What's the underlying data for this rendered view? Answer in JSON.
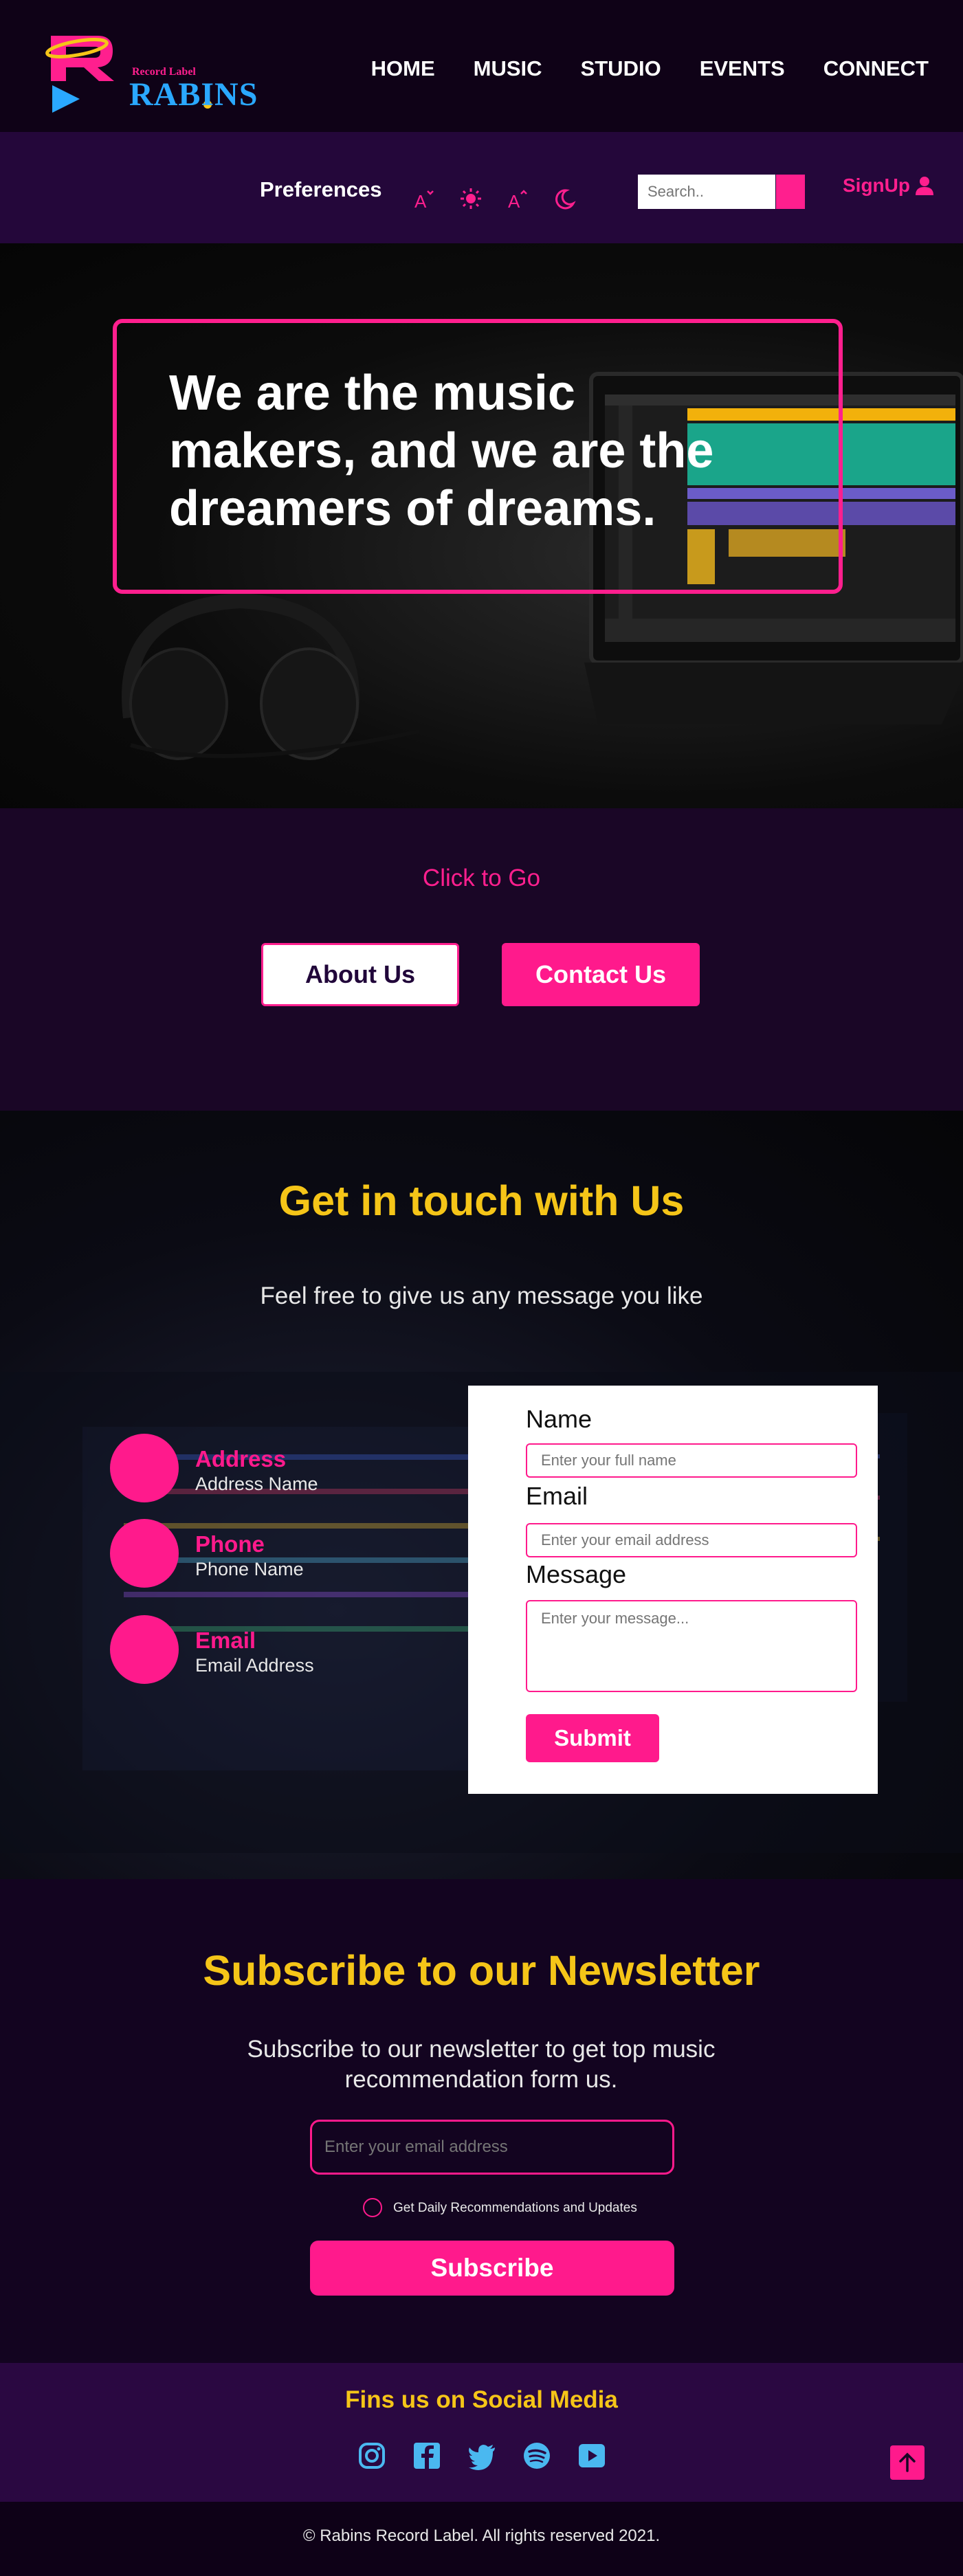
{
  "brand": {
    "small": "Record Label",
    "big": "RABINS"
  },
  "nav": {
    "items": [
      "HOME",
      "MUSIC",
      "STUDIO",
      "EVENTS",
      "CONNECT"
    ]
  },
  "prefs": {
    "label": "Preferences",
    "icons": [
      "font-increase-icon",
      "brightness-icon",
      "font-decrease-icon",
      "moon-icon"
    ],
    "search_placeholder": "Search..",
    "signup": "SignUp"
  },
  "hero": {
    "text": "We are the music makers, and we are the dreamers of dreams."
  },
  "cta": {
    "label": "Click to Go",
    "about": "About Us",
    "contact": "Contact Us"
  },
  "contact": {
    "title": "Get in touch with Us",
    "subtitle": "Feel free to give us any message you like",
    "info": [
      {
        "title": "Address",
        "value": "Address Name"
      },
      {
        "title": "Phone",
        "value": "Phone Name"
      },
      {
        "title": "Email",
        "value": "Email Address"
      }
    ],
    "form": {
      "name_label": "Name",
      "name_placeholder": "Enter your full name",
      "email_label": "Email",
      "email_placeholder": "Enter your email address",
      "message_label": "Message",
      "message_placeholder": "Enter your message...",
      "submit": "Submit"
    }
  },
  "newsletter": {
    "title": "Subscribe to our Newsletter",
    "subtitle": "Subscribe to our newsletter to get top music recommendation form us.",
    "email_placeholder": "Enter your email address",
    "checkbox_label": "Get Daily Recommendations and Updates",
    "button": "Subscribe"
  },
  "social": {
    "title": "Fins us on Social Media",
    "icons": [
      "instagram-icon",
      "facebook-icon",
      "twitter-icon",
      "spotify-icon",
      "youtube-icon"
    ]
  },
  "footer": {
    "copyright": "© Rabins Record Label. All rights reserved 2021."
  },
  "colors": {
    "accent": "#ff1a8c",
    "yellow": "#f5c518",
    "nav_bg": "#0f0217",
    "prefs_bg": "#24073a"
  }
}
